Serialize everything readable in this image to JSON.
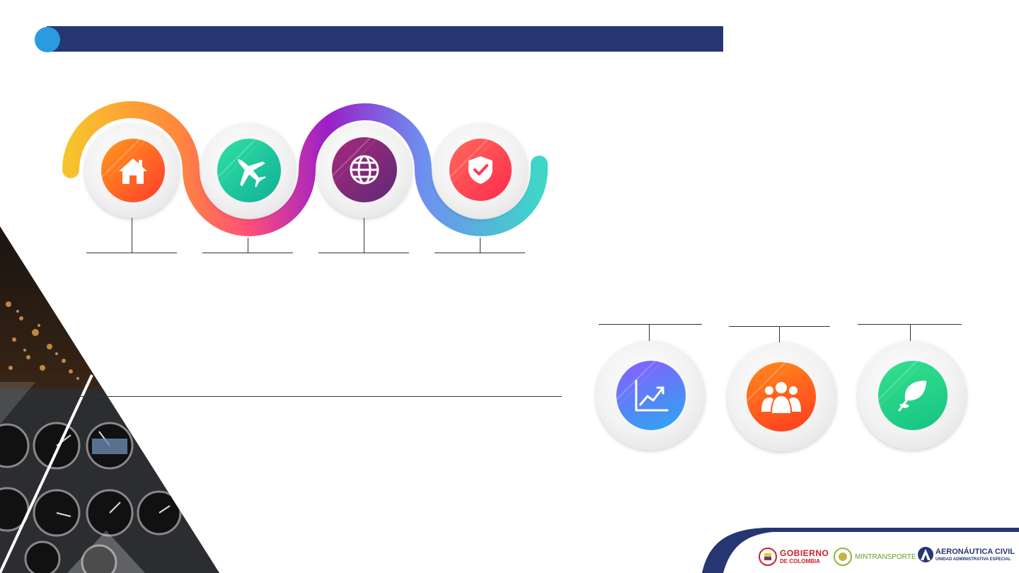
{
  "header": {
    "bar_color": "#263672",
    "dot_color": "#2a9be0"
  },
  "timeline": {
    "items": [
      {
        "icon": "home-icon",
        "colors": [
          "#ff8a1a",
          "#ff3b2e"
        ]
      },
      {
        "icon": "airplane-icon",
        "colors": [
          "#2fe0a0",
          "#14b89a"
        ]
      },
      {
        "icon": "globe-icon",
        "colors": [
          "#a8287a",
          "#6a2a7a"
        ]
      },
      {
        "icon": "shield-check-icon",
        "colors": [
          "#ff6a5a",
          "#ff2f4e"
        ]
      }
    ]
  },
  "bottom_items": [
    {
      "icon": "growth-chart-icon",
      "colors": [
        "#8a5cff",
        "#2aa8f0"
      ]
    },
    {
      "icon": "group-people-icon",
      "colors": [
        "#ff8a1a",
        "#ff3b22"
      ]
    },
    {
      "icon": "leaf-icon",
      "colors": [
        "#35e08a",
        "#14c486"
      ]
    }
  ],
  "footer_logos": {
    "gobierno_line1": "GOBIERNO",
    "gobierno_line2": "DE COLOMBIA",
    "mintransporte": "MINTRANSPORTE",
    "aeronautica_line1": "AERONÁUTICA CIVIL",
    "aeronautica_line2": "UNIDAD ADMINISTRATIVA ESPECIAL"
  }
}
